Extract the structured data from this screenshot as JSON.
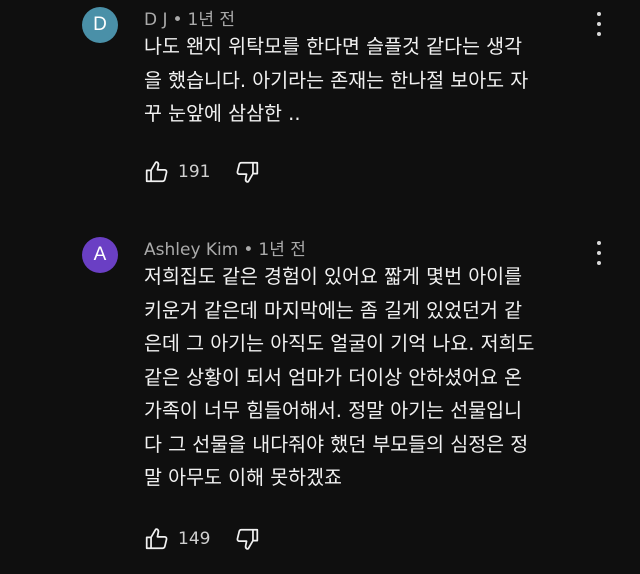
{
  "comments": [
    {
      "avatar_letter": "D",
      "avatar_color": "#4a90a8",
      "author": "D J",
      "separator": "•",
      "time": "1년 전",
      "lines": [
        "나도 왠지 위탁모를 한다면 슬플것 같다는 생각",
        "을 했습니다. 아기라는 존재는 한나절 보아도 자",
        "꾸 눈앞에 삼삼한 .."
      ],
      "likes": "191",
      "icons": [
        "thumbs-up-icon",
        "thumbs-down-icon",
        "more-vert-icon"
      ]
    },
    {
      "avatar_letter": "A",
      "avatar_color": "#6a3fc4",
      "author": "Ashley Kim",
      "separator": "•",
      "time": "1년 전",
      "lines": [
        "저희집도 같은 경험이 있어요 짧게 몇번 아이를",
        "키운거 같은데 마지막에는 좀 길게 있었던거 같",
        "은데 그 아기는 아직도 얼굴이 기억 나요. 저희도",
        "같은 상황이 되서 엄마가 더이상 안하셨어요 온",
        "가족이 너무 힘들어해서. 정말 아기는 선물입니",
        "다 그 선물을 내다줘야 했던 부모들의 심정은 정",
        "말 아무도 이해 못하겠죠"
      ],
      "likes": "149",
      "icons": [
        "thumbs-up-icon",
        "thumbs-down-icon",
        "more-vert-icon"
      ]
    }
  ]
}
